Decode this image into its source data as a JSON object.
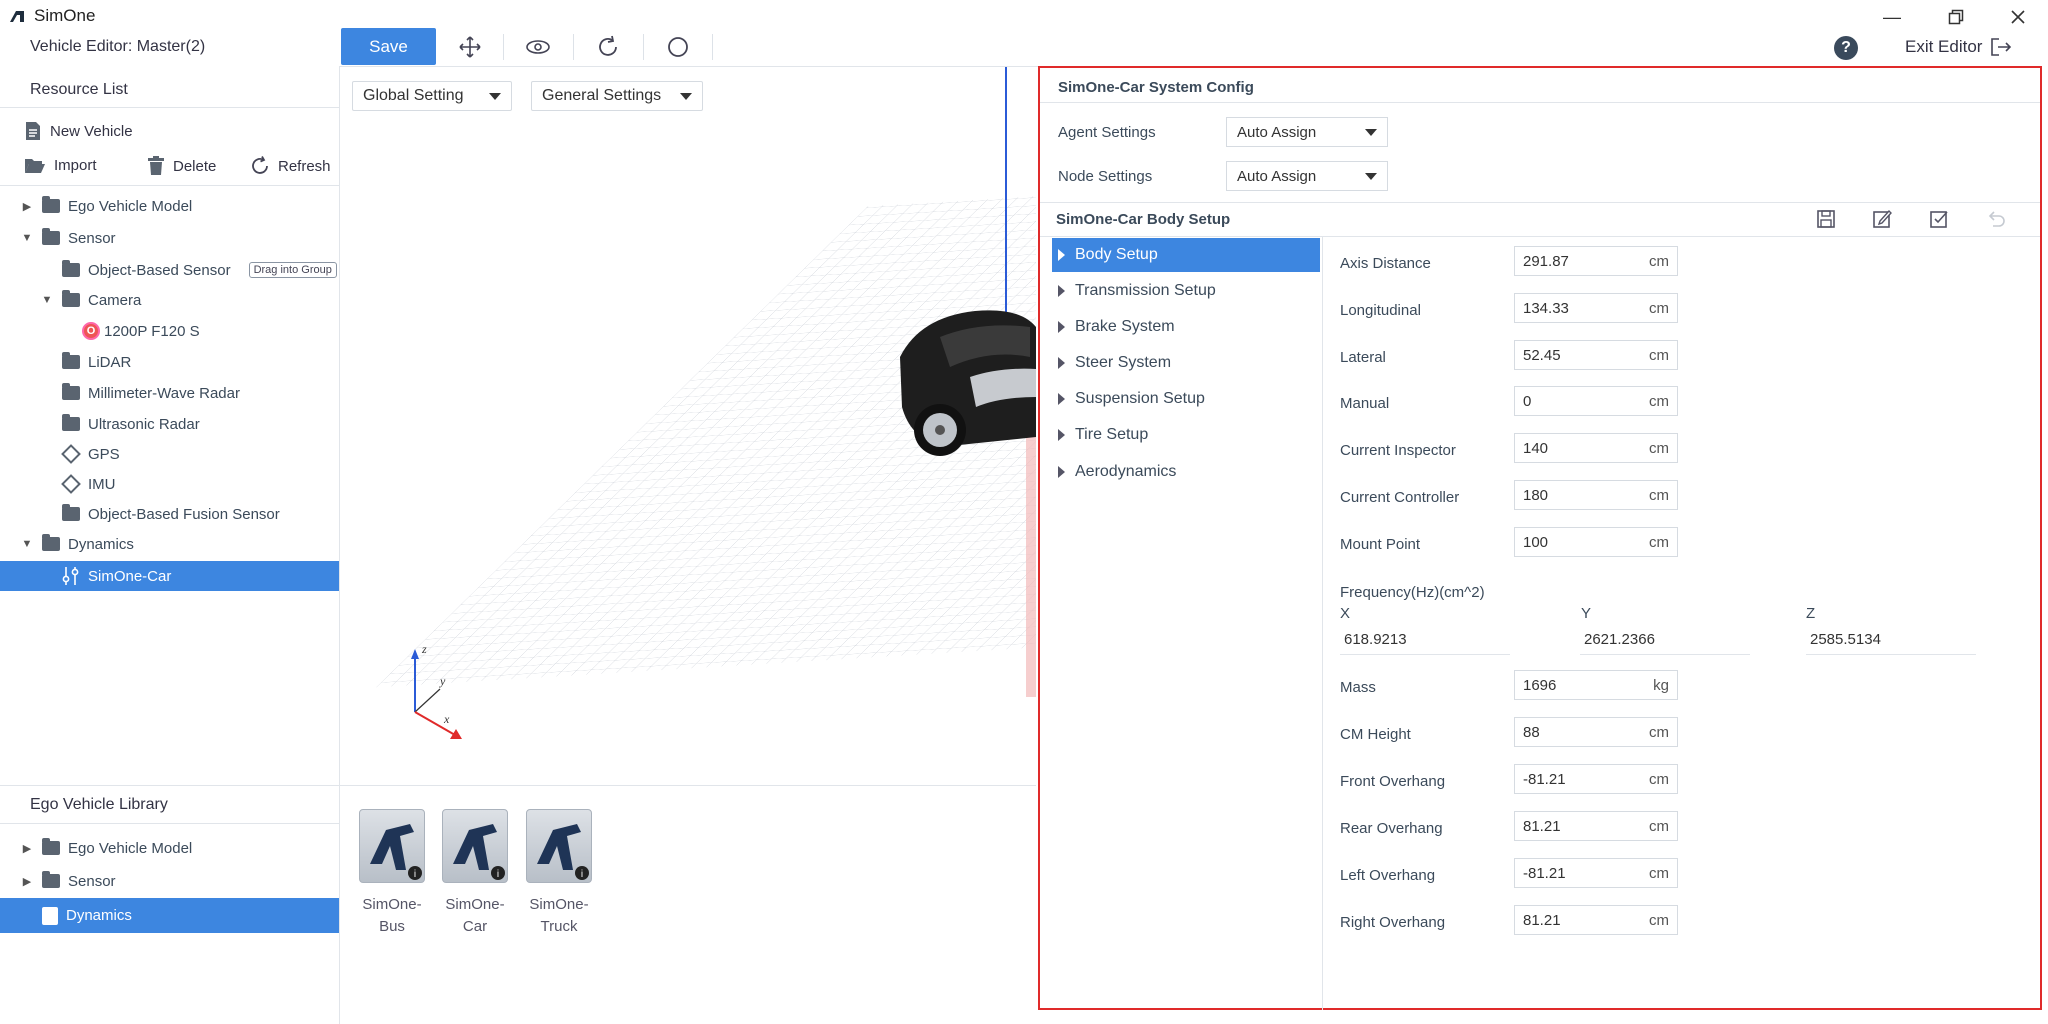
{
  "app": {
    "title": "SimOne"
  },
  "editor": {
    "title": "Vehicle Editor: Master(2)"
  },
  "toolbar": {
    "save_label": "Save"
  },
  "exit_editor": {
    "label": "Exit Editor"
  },
  "resource_list": {
    "title": "Resource List",
    "actions": {
      "new_vehicle": "New Vehicle",
      "import": "Import",
      "delete": "Delete",
      "refresh": "Refresh"
    },
    "tree": {
      "ego_vehicle_model": "Ego Vehicle Model",
      "sensor": "Sensor",
      "object_based_sensor": "Object-Based Sensor",
      "drag_badge": "Drag into Group",
      "camera": "Camera",
      "camera_item": "1200P F120 S",
      "lidar": "LiDAR",
      "mmw_radar": "Millimeter-Wave Radar",
      "ultrasonic_radar": "Ultrasonic Radar",
      "gps": "GPS",
      "imu": "IMU",
      "fusion_sensor": "Object-Based Fusion Sensor",
      "dynamics": "Dynamics",
      "simone_car": "SimOne-Car"
    }
  },
  "ego_library": {
    "title": "Ego Vehicle Library",
    "tree": {
      "ego_vehicle_model": "Ego Vehicle Model",
      "sensor": "Sensor",
      "dynamics": "Dynamics"
    },
    "cards": [
      {
        "line1": "SimOne-",
        "line2": "Bus"
      },
      {
        "line1": "SimOne-",
        "line2": "Car"
      },
      {
        "line1": "SimOne-",
        "line2": "Truck"
      }
    ]
  },
  "viewport": {
    "global_setting": "Global Setting",
    "general_settings": "General Settings",
    "axis": {
      "z": "z",
      "y": "y",
      "x": "x"
    }
  },
  "system_config": {
    "title": "SimOne-Car System Config",
    "agent_label": "Agent Settings",
    "agent_value": "Auto Assign",
    "node_label": "Node Settings",
    "node_value": "Auto Assign"
  },
  "body_setup": {
    "title": "SimOne-Car Body Setup",
    "nav": [
      "Body Setup",
      "Transmission Setup",
      "Brake System",
      "Steer System",
      "Suspension Setup",
      "Tire Setup",
      "Aerodynamics"
    ],
    "fields_top": [
      {
        "label": "Axis Distance",
        "value": "291.87",
        "unit": "cm"
      },
      {
        "label": "Longitudinal",
        "value": "134.33",
        "unit": "cm"
      },
      {
        "label": "Lateral",
        "value": "52.45",
        "unit": "cm"
      },
      {
        "label": "Manual",
        "value": "0",
        "unit": "cm"
      },
      {
        "label": "Current Inspector",
        "value": "140",
        "unit": "cm"
      },
      {
        "label": "Current Controller",
        "value": "180",
        "unit": "cm"
      },
      {
        "label": "Mount Point",
        "value": "100",
        "unit": "cm"
      }
    ],
    "frequency": {
      "label": "Frequency(Hz)(cm^2)",
      "x_label": "X",
      "y_label": "Y",
      "z_label": "Z",
      "x_value": "618.9213",
      "y_value": "2621.2366",
      "z_value": "2585.5134"
    },
    "fields_bottom": [
      {
        "label": "Mass",
        "value": "1696",
        "unit": "kg"
      },
      {
        "label": "CM Height",
        "value": "88",
        "unit": "cm"
      },
      {
        "label": "Front Overhang",
        "value": "-81.21",
        "unit": "cm"
      },
      {
        "label": "Rear Overhang",
        "value": "81.21",
        "unit": "cm"
      },
      {
        "label": "Left Overhang",
        "value": "-81.21",
        "unit": "cm"
      },
      {
        "label": "Right Overhang",
        "value": "81.21",
        "unit": "cm"
      }
    ]
  },
  "colors": {
    "accent": "#3d86e0",
    "highlight_border": "#e02a2a"
  }
}
